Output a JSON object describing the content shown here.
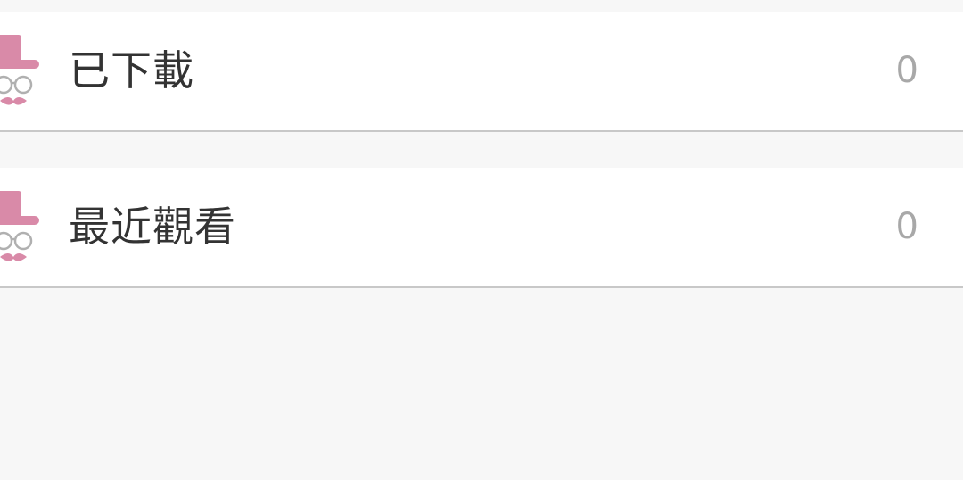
{
  "list": {
    "items": [
      {
        "label": "已下載",
        "count": "0",
        "icon": "gentleman-avatar-icon"
      },
      {
        "label": "最近觀看",
        "count": "0",
        "icon": "gentleman-avatar-icon"
      }
    ]
  },
  "colors": {
    "background": "#f7f7f7",
    "row": "#ffffff",
    "divider": "#c8c8c8",
    "label": "#333333",
    "count": "#a8a8a8",
    "avatar_pink": "#d98aa8"
  }
}
